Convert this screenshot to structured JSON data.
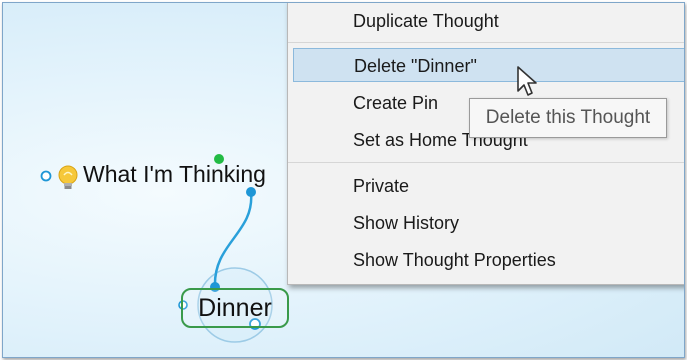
{
  "map": {
    "thoughts": [
      {
        "label": "What I'm Thinking",
        "icon": "lightbulb-icon"
      },
      {
        "label": "Dinner",
        "selected": true
      }
    ]
  },
  "context_menu": {
    "items": [
      {
        "label": "Duplicate Thought"
      },
      {
        "label": "Delete \"Dinner\"",
        "highlighted": true
      },
      {
        "label": "Create Pin"
      },
      {
        "label": "Set as Home Thought"
      },
      {
        "label": "Private"
      },
      {
        "label": "Show History"
      },
      {
        "label": "Show Thought Properties"
      }
    ]
  },
  "tooltip": {
    "text": "Delete this Thought"
  },
  "colors": {
    "link": "#2aa0da",
    "selection_border": "#3a9a4a",
    "menu_highlight": "#cfe2f1",
    "gate_green": "#22bb44"
  }
}
